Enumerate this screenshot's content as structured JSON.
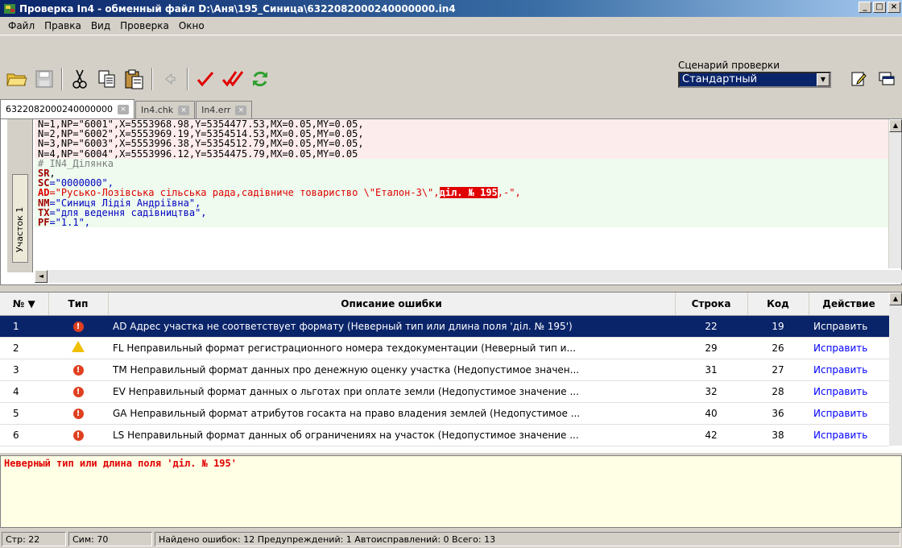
{
  "window": {
    "title": "Проверка In4 - обменный файл D:\\Аня\\195_Синица\\6322082000240000000.in4",
    "min": "_",
    "max": "□",
    "close": "×"
  },
  "menu": [
    "Файл",
    "Правка",
    "Вид",
    "Проверка",
    "Окно"
  ],
  "scenario": {
    "label": "Сценарий проверки",
    "value": "Стандартный"
  },
  "tabs": [
    {
      "label": "6322082000240000000"
    },
    {
      "label": "In4.chk"
    },
    {
      "label": "In4.err"
    }
  ],
  "editor": {
    "section_label": "Участок 1",
    "lines_pink": [
      "N=1,NP=\"6001\",X=5553968.98,Y=5354477.53,MX=0.05,MY=0.05,",
      "N=2,NP=\"6002\",X=5553969.19,Y=5354514.53,MX=0.05,MY=0.05,",
      "N=3,NP=\"6003\",X=5553996.38,Y=5354512.79,MX=0.05,MY=0.05,",
      "N=4,NP=\"6004\",X=5553996.12,Y=5354475.79,MX=0.05,MY=0.05"
    ],
    "comment": "# IN4_Ділянка",
    "sr": "SR",
    "sr_tail": ",",
    "sc_key": "SC",
    "sc_val": "=\"0000000\",",
    "ad_key": "AD",
    "ad_val": "=\"Русько-Лозівська сільська рада,садівниче товариство \\\"Еталон-3\\\",",
    "ad_sel": "діл. № 195",
    "ad_tail": ",-\",",
    "nm_key": "NM",
    "nm_val": "=\"Синиця Лідія Андріївна\",",
    "tx_key": "TX",
    "tx_val": "=\"для ведення садівництва\",",
    "pf_key": "PF",
    "pf_val": "=\"1.1\","
  },
  "grid": {
    "headers": {
      "num": "№ ▼",
      "type": "Тип",
      "desc": "Описание ошибки",
      "row": "Строка",
      "code": "Код",
      "action": "Действие"
    },
    "rows": [
      {
        "n": "1",
        "type": "error",
        "desc": "AD Адрес участка не соответствует формату (Неверный тип или длина поля 'діл. № 195')",
        "row": "22",
        "code": "19",
        "action": "Исправить"
      },
      {
        "n": "2",
        "type": "warning",
        "desc": "FL Неправильный формат регистрационного номера техдокументации (Неверный тип и...",
        "row": "29",
        "code": "26",
        "action": "Исправить"
      },
      {
        "n": "3",
        "type": "error",
        "desc": "TM Неправильный формат данных про денежную оценку участка (Недопустимое значен...",
        "row": "31",
        "code": "27",
        "action": "Исправить"
      },
      {
        "n": "4",
        "type": "error",
        "desc": "EV Неправильный формат данных о льготах при оплате земли (Недопустимое значение ...",
        "row": "32",
        "code": "28",
        "action": "Исправить"
      },
      {
        "n": "5",
        "type": "error",
        "desc": "GA Неправильный формат атрибутов госакта на право владения землей (Недопустимое ...",
        "row": "40",
        "code": "36",
        "action": "Исправить"
      },
      {
        "n": "6",
        "type": "error",
        "desc": "LS Неправильный формат данных об ограничениях на участок (Недопустимое значение ...",
        "row": "42",
        "code": "38",
        "action": "Исправить"
      }
    ]
  },
  "message": "Неверный тип или длина поля 'діл. № 195'",
  "status": {
    "line": "Стр: 22",
    "col": "Сим: 70",
    "summary": "Найдено ошибок: 12 Предупреждений: 1 Автоисправлений: 0 Всего: 13"
  }
}
